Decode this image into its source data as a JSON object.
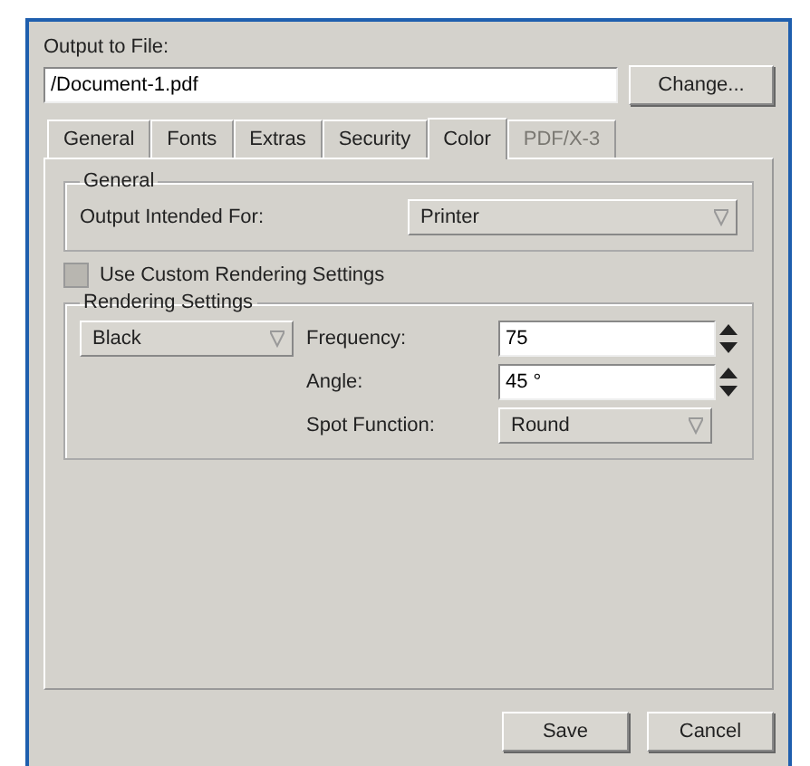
{
  "output_label": "Output to File:",
  "file_field": {
    "value": "/Document-1.pdf"
  },
  "change_button": "Change...",
  "tabs": [
    {
      "label": "General",
      "selected": false,
      "disabled": false
    },
    {
      "label": "Fonts",
      "selected": false,
      "disabled": false
    },
    {
      "label": "Extras",
      "selected": false,
      "disabled": false
    },
    {
      "label": "Security",
      "selected": false,
      "disabled": false
    },
    {
      "label": "Color",
      "selected": true,
      "disabled": false
    },
    {
      "label": "PDF/X-3",
      "selected": false,
      "disabled": true
    }
  ],
  "general_group": {
    "title": "General",
    "label": "Output Intended For:",
    "value": "Printer"
  },
  "custom_rendering": {
    "label": "Use Custom Rendering Settings",
    "checked": false
  },
  "rendering_group": {
    "title": "Rendering Settings",
    "color_select": "Black",
    "fields": [
      {
        "kind": "spin",
        "label": "Frequency:",
        "value": "75"
      },
      {
        "kind": "spin",
        "label": "Angle:",
        "value": "45 °"
      },
      {
        "kind": "select",
        "label": "Spot Function:",
        "value": "Round"
      }
    ]
  },
  "buttons": [
    "Save",
    "Cancel"
  ]
}
